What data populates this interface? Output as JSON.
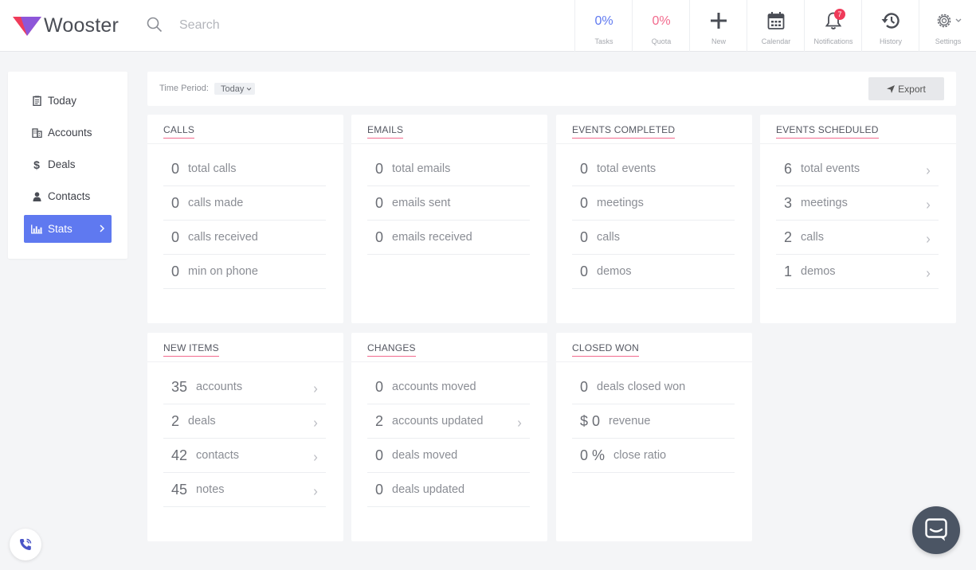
{
  "brand": {
    "name": "Wooster",
    "accent": "#5f79f0",
    "logo_colors": [
      "#ef3b5a",
      "#7b5cf0"
    ]
  },
  "search": {
    "placeholder": "Search"
  },
  "topnav": {
    "tasks": {
      "value": "0%",
      "label": "Tasks",
      "color": "#5f79f0"
    },
    "quota": {
      "value": "0%",
      "label": "Quota",
      "color": "#f26a8d"
    },
    "new": {
      "label": "New",
      "icon": "plus-icon"
    },
    "calendar": {
      "label": "Calendar",
      "icon": "calendar-icon"
    },
    "notifications": {
      "label": "Notifications",
      "icon": "bell-icon",
      "badge": "7"
    },
    "history": {
      "label": "History",
      "icon": "history-icon"
    },
    "settings": {
      "label": "Settings",
      "icon": "gear-icon"
    }
  },
  "sidebar": {
    "items": [
      {
        "label": "Today",
        "icon": "clipboard-icon"
      },
      {
        "label": "Accounts",
        "icon": "building-icon"
      },
      {
        "label": "Deals",
        "icon": "dollar-icon"
      },
      {
        "label": "Contacts",
        "icon": "person-icon"
      },
      {
        "label": "Stats",
        "icon": "bar-chart-icon",
        "active": true
      }
    ]
  },
  "toolbar": {
    "time_period_label": "Time Period:",
    "time_period_value": "Today",
    "export_label": "Export"
  },
  "cards": {
    "calls": {
      "title": "CALLS",
      "rows": [
        {
          "value": "0",
          "label": "total calls"
        },
        {
          "value": "0",
          "label": "calls made"
        },
        {
          "value": "0",
          "label": "calls received"
        },
        {
          "value": "0",
          "label": "min on phone"
        }
      ]
    },
    "emails": {
      "title": "EMAILS",
      "rows": [
        {
          "value": "0",
          "label": "total emails"
        },
        {
          "value": "0",
          "label": "emails sent"
        },
        {
          "value": "0",
          "label": "emails received"
        }
      ]
    },
    "events_completed": {
      "title": "EVENTS COMPLETED",
      "rows": [
        {
          "value": "0",
          "label": "total events"
        },
        {
          "value": "0",
          "label": "meetings"
        },
        {
          "value": "0",
          "label": "calls"
        },
        {
          "value": "0",
          "label": "demos"
        }
      ]
    },
    "events_scheduled": {
      "title": "EVENTS SCHEDULED",
      "rows": [
        {
          "value": "6",
          "label": "total events"
        },
        {
          "value": "3",
          "label": "meetings"
        },
        {
          "value": "2",
          "label": "calls"
        },
        {
          "value": "1",
          "label": "demos"
        }
      ]
    },
    "new_items": {
      "title": "NEW ITEMS",
      "rows": [
        {
          "value": "35",
          "label": "accounts"
        },
        {
          "value": "2",
          "label": "deals"
        },
        {
          "value": "42",
          "label": "contacts"
        },
        {
          "value": "45",
          "label": "notes"
        }
      ]
    },
    "changes": {
      "title": "CHANGES",
      "rows": [
        {
          "value": "0",
          "label": "accounts moved"
        },
        {
          "value": "2",
          "label": "accounts updated"
        },
        {
          "value": "0",
          "label": "deals moved"
        },
        {
          "value": "0",
          "label": "deals updated"
        }
      ]
    },
    "closed_won": {
      "title": "CLOSED WON",
      "rows": [
        {
          "value": "0",
          "label": "deals closed won"
        },
        {
          "value": "$ 0",
          "label": "revenue"
        },
        {
          "value": "0 %",
          "label": "close ratio"
        }
      ]
    }
  }
}
